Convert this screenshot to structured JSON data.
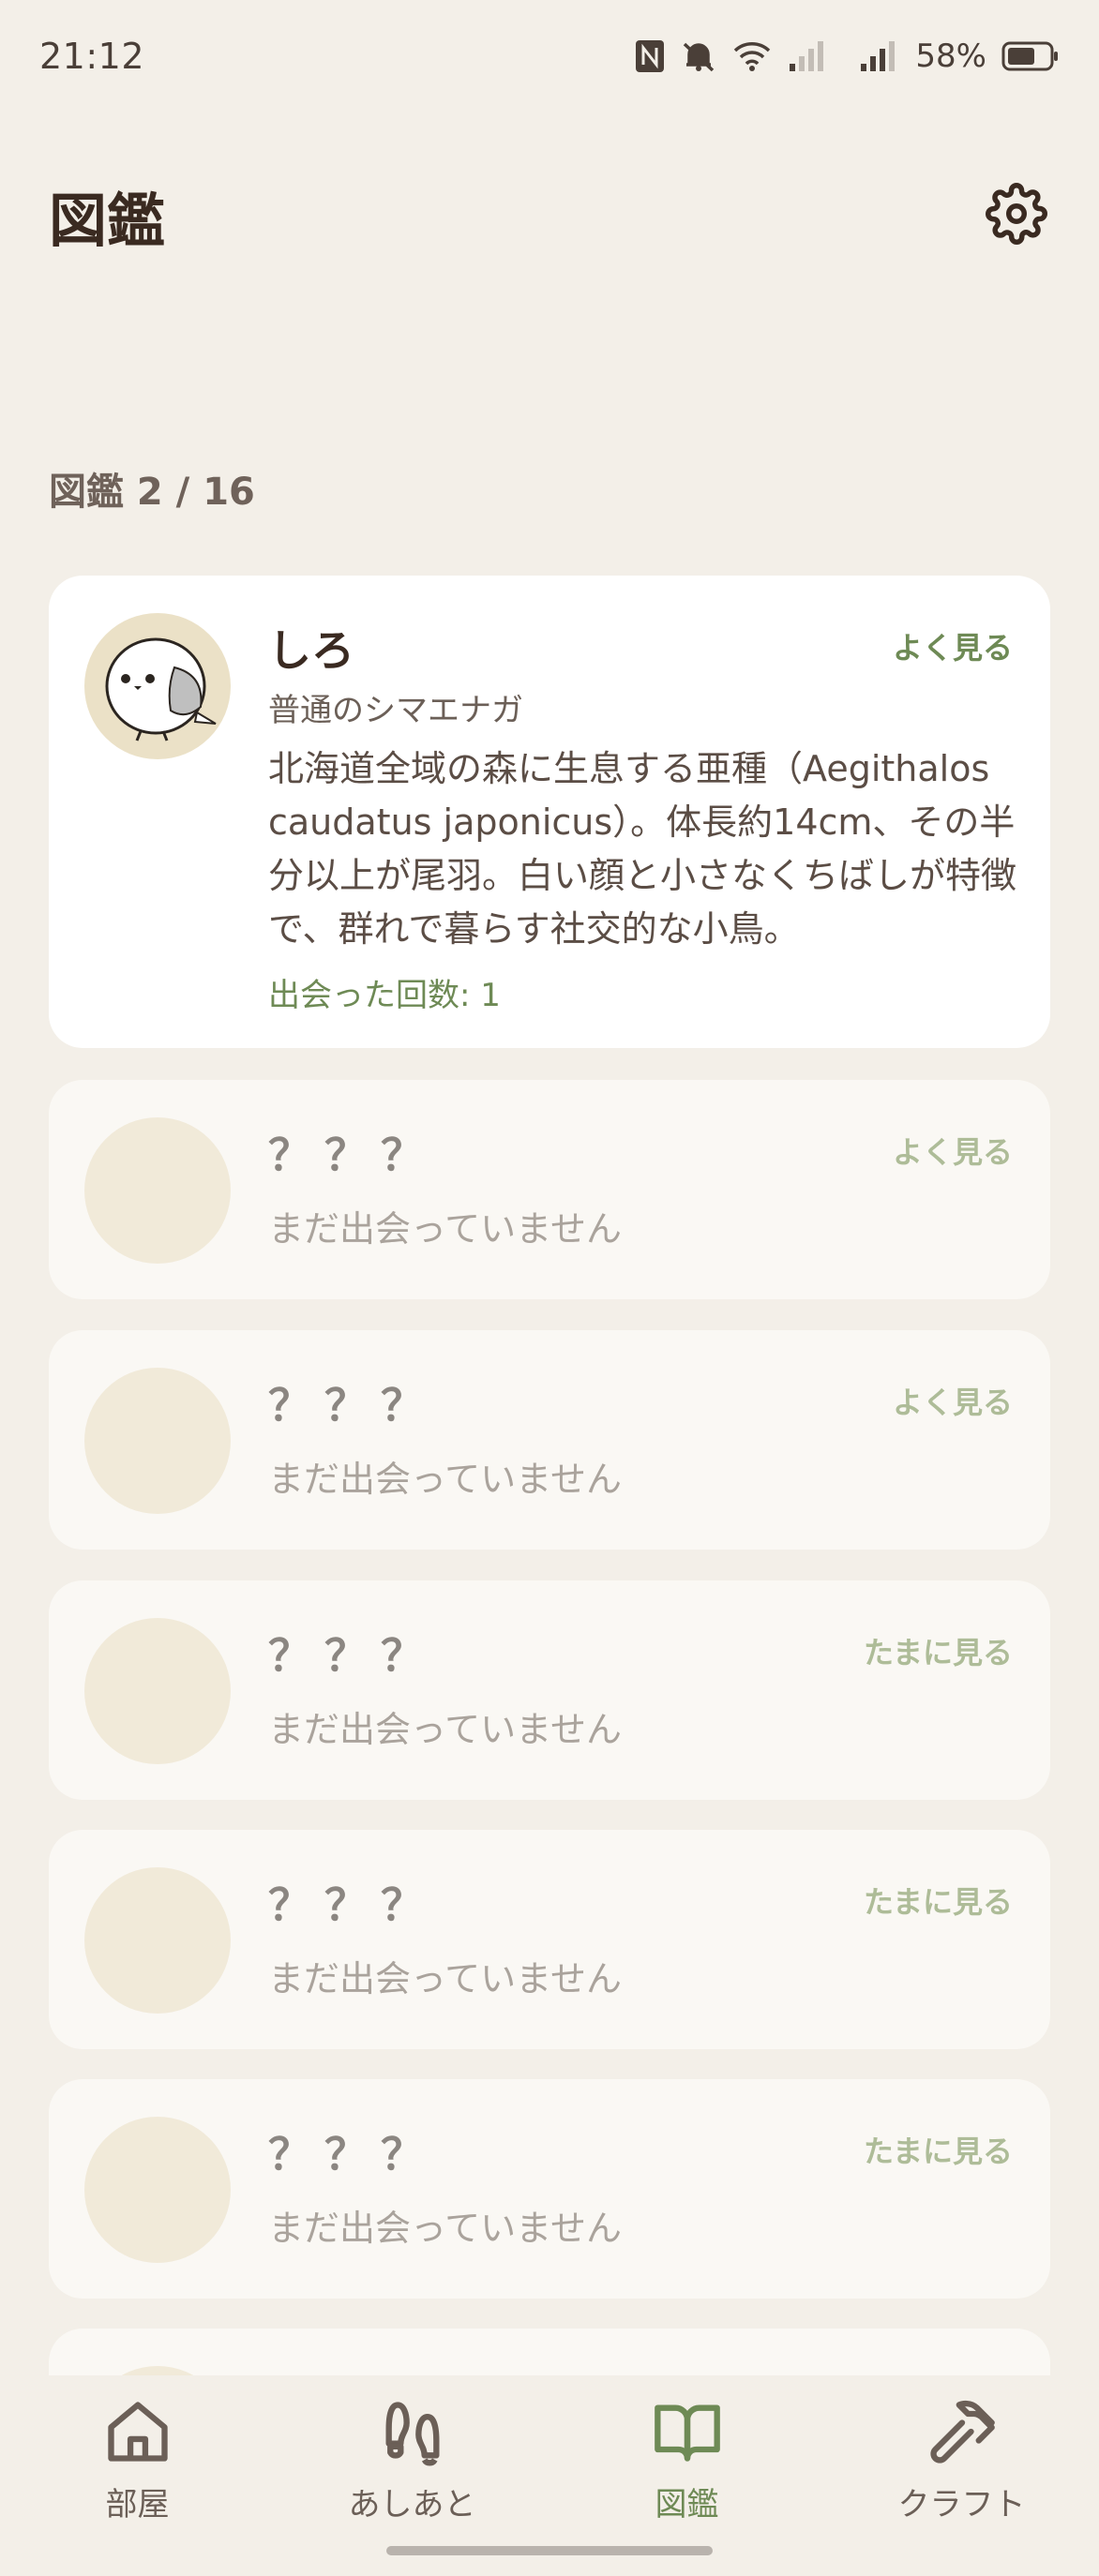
{
  "status": {
    "time": "21:12",
    "battery": "58%",
    "icons": [
      "nfc-icon",
      "bell-off-icon",
      "wifi-icon",
      "signal-weak-icon",
      "signal-icon",
      "battery-icon"
    ]
  },
  "header": {
    "title": "図鑑",
    "settings_icon": "gear-icon"
  },
  "count_label": "図鑑 2 / 16",
  "cards": [
    {
      "name": "しろ",
      "frequency": "よく見る",
      "subtitle": "普通のシマエナガ",
      "description": "北海道全域の森に生息する亜種（Aegithalos caudatus japonicus）。体長約14cm、その半分以上が尾羽。白い顔と小さなくちばしが特徴で、群れで暮らす社交的な小鳥。",
      "encounters": "出会った回数: 1"
    },
    {
      "name": "？？？",
      "frequency": "よく見る",
      "subtitle": "まだ出会っていません"
    },
    {
      "name": "？？？",
      "frequency": "よく見る",
      "subtitle": "まだ出会っていません"
    },
    {
      "name": "？？？",
      "frequency": "たまに見る",
      "subtitle": "まだ出会っていません"
    },
    {
      "name": "？？？",
      "frequency": "たまに見る",
      "subtitle": "まだ出会っていません"
    },
    {
      "name": "？？？",
      "frequency": "たまに見る",
      "subtitle": "まだ出会っていません"
    }
  ],
  "nav": [
    {
      "label": "部屋",
      "icon": "home-icon"
    },
    {
      "label": "あしあと",
      "icon": "footprints-icon"
    },
    {
      "label": "図鑑",
      "icon": "book-icon",
      "active": true
    },
    {
      "label": "クラフト",
      "icon": "hammer-icon"
    }
  ],
  "colors": {
    "background": "#f3efe8",
    "accent_green": "#6e8a55",
    "title_brown": "#3a2a21"
  }
}
